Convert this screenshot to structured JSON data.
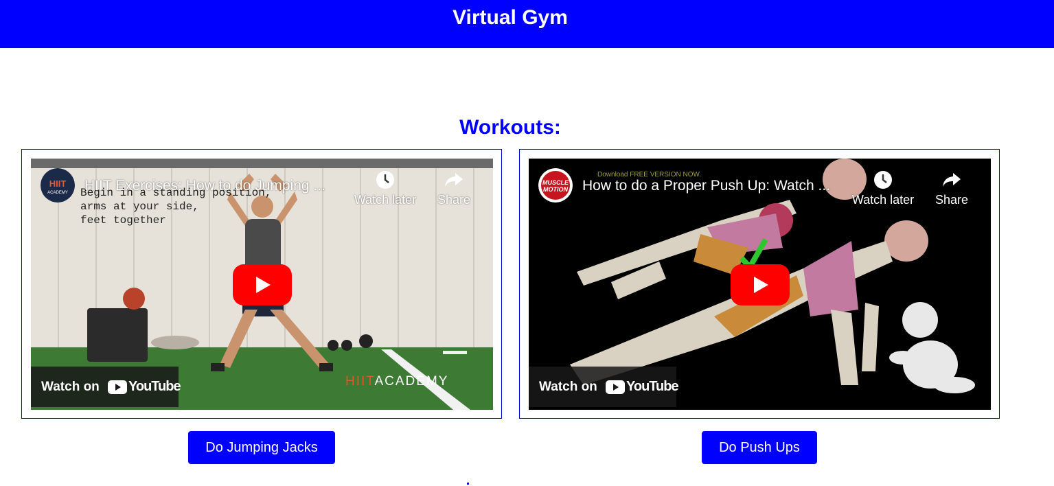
{
  "header": {
    "title": "Virtual Gym"
  },
  "section": {
    "title": "Workouts:"
  },
  "videos": [
    {
      "title": "HIIT Exercises: How to do Jumping ...",
      "channel_logo_text": "HIIT ACADEMY",
      "watch_later_label": "Watch later",
      "share_label": "Share",
      "watch_on_label": "Watch on",
      "youtube_label": "YouTube",
      "overlay_text": [
        "Begin in a standing position,",
        "arms at your side,",
        "feet together"
      ],
      "watermark_hi": "HIIT",
      "watermark_rest": "ACADEMY"
    },
    {
      "title": "How to do a Proper Push Up: Watch ...",
      "channel_logo_text": "MUSCLE MOTION",
      "watch_later_label": "Watch later",
      "share_label": "Share",
      "watch_on_label": "Watch on",
      "youtube_label": "YouTube",
      "download_note": "Download FREE VERSION NOW."
    }
  ],
  "buttons": {
    "jumping_jacks": "Do Jumping Jacks",
    "push_ups": "Do Push Ups"
  },
  "colors": {
    "primary": "#0000ff",
    "youtube_red": "#ff0000"
  }
}
